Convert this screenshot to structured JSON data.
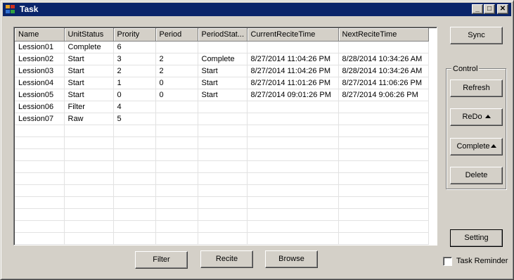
{
  "window": {
    "title": "Task",
    "minimize_glyph": "_",
    "maximize_glyph": "□",
    "close_glyph": "✕"
  },
  "grid": {
    "columns": [
      "Name",
      "UnitStatus",
      "Prority",
      "Period",
      "PeriodStat...",
      "CurrentReciteTime",
      "NextReciteTime"
    ],
    "rows": [
      [
        "Lession01",
        "Complete",
        "6",
        "",
        "",
        "",
        ""
      ],
      [
        "Lession02",
        "Start",
        "3",
        "2",
        "Complete",
        "8/27/2014 11:04:26 PM",
        "8/28/2014 10:34:26 AM"
      ],
      [
        "Lession03",
        "Start",
        "2",
        "2",
        "Start",
        "8/27/2014 11:04:26 PM",
        "8/28/2014 10:34:26 AM"
      ],
      [
        "Lession04",
        "Start",
        "1",
        "0",
        "Start",
        "8/27/2014 11:01:26 PM",
        "8/27/2014 11:06:26 PM"
      ],
      [
        "Lession05",
        "Start",
        "0",
        "0",
        "Start",
        "8/27/2014 09:01:26 PM",
        "8/27/2014 9:06:26 PM"
      ],
      [
        "Lession06",
        "Filter",
        "4",
        "",
        "",
        "",
        ""
      ],
      [
        "Lession07",
        "Raw",
        "5",
        "",
        "",
        "",
        ""
      ]
    ],
    "empty_rows": 11
  },
  "buttons": {
    "sync": "Sync",
    "refresh": "Refresh",
    "redo": "ReDo",
    "complete": "Complete",
    "delete": "Delete",
    "setting": "Setting",
    "filter": "Filter",
    "recite": "Recite",
    "browse": "Browse"
  },
  "control_group": {
    "label": "Control"
  },
  "task_reminder": {
    "label": "Task Reminder",
    "checked": false
  }
}
